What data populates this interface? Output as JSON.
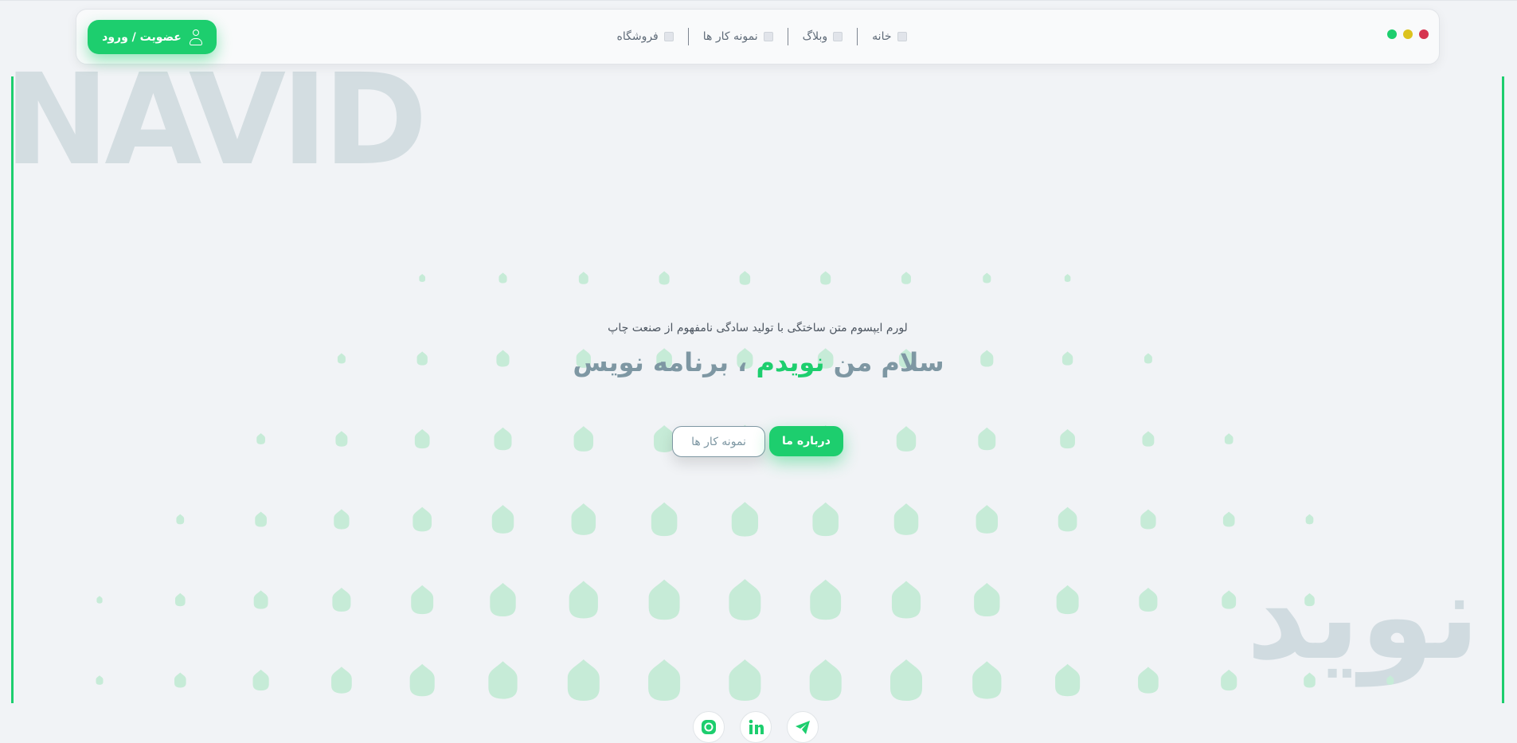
{
  "colors": {
    "accent": "#1dce6e",
    "muted_title": "#7e97a3",
    "window_red": "#d6344f",
    "window_yellow": "#dcc31e",
    "window_green": "#1dce6e"
  },
  "header": {
    "login_label": "عضویت / ورود",
    "login_icon": "user-icon",
    "menu": [
      {
        "label": "خانه",
        "icon": "square-icon"
      },
      {
        "label": "وبلاگ",
        "icon": "square-icon"
      },
      {
        "label": "نمونه کار ها",
        "icon": "square-icon"
      },
      {
        "label": "فروشگاه",
        "icon": "square-icon"
      }
    ]
  },
  "background": {
    "watermark_en": "NAVID",
    "watermark_fa": "نوید"
  },
  "hero": {
    "subtitle": "لورم ایپسوم متن ساختگی با تولید سادگی نامفهوم از صنعت چاپ",
    "title_prefix": "سلام من ",
    "title_accent": "نویدم",
    "title_suffix": " ، برنامه نویس",
    "primary_button": "درباره ما",
    "secondary_button": "نمونه کار ها"
  },
  "socials": [
    {
      "name": "instagram-icon"
    },
    {
      "name": "linkedin-icon"
    },
    {
      "name": "telegram-icon"
    }
  ]
}
